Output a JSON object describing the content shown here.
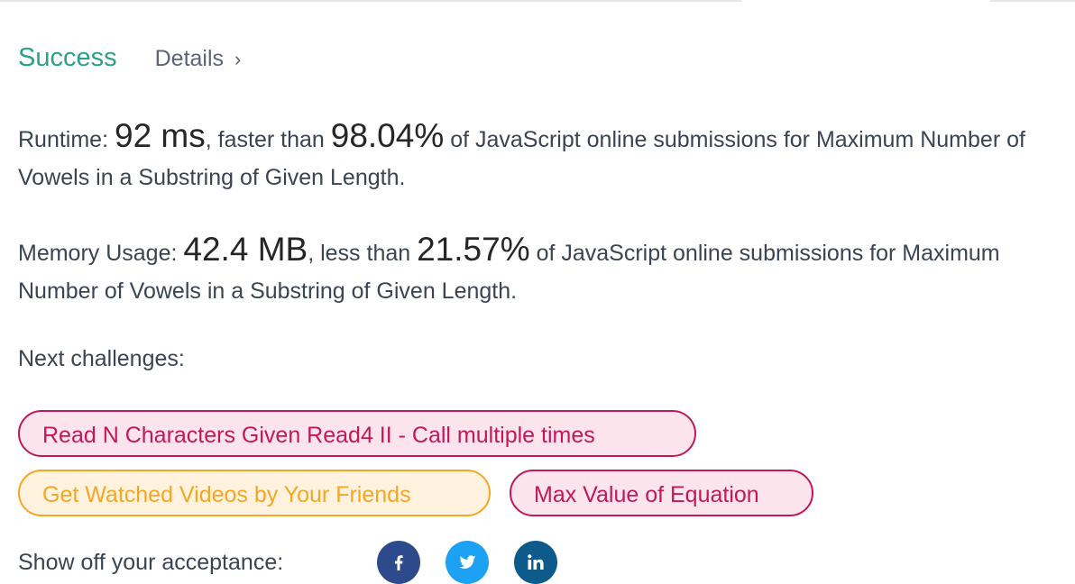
{
  "header": {
    "status": "Success",
    "details_label": "Details",
    "details_chevron": "›"
  },
  "runtime": {
    "label": "Runtime:",
    "value": "92 ms",
    "mid": ", faster than",
    "percent": "98.04%",
    "suffix": "of JavaScript online submissions for Maximum Number of Vowels in a Substring of Given Length."
  },
  "memory": {
    "label": "Memory Usage:",
    "value": "42.4 MB",
    "mid": ", less than",
    "percent": "21.57%",
    "suffix": "of JavaScript online submissions for Maximum Number of Vowels in a Substring of Given Length."
  },
  "next": {
    "label": "Next challenges:",
    "challenges": [
      {
        "title": "Read N Characters Given Read4 II - Call multiple times",
        "difficulty": "hard",
        "color": "#c2185b"
      },
      {
        "title": "Get Watched Videos by Your Friends",
        "difficulty": "medium",
        "color": "#f5a623"
      },
      {
        "title": "Max Value of Equation",
        "difficulty": "hard",
        "color": "#c2185b"
      }
    ]
  },
  "share": {
    "label": "Show off your acceptance:",
    "icons": [
      "facebook-icon",
      "twitter-icon",
      "linkedin-icon"
    ]
  },
  "colors": {
    "success": "#2ba08a",
    "facebook": "#2d4b8c",
    "twitter": "#1da1f2",
    "linkedin": "#0e5a8a"
  }
}
